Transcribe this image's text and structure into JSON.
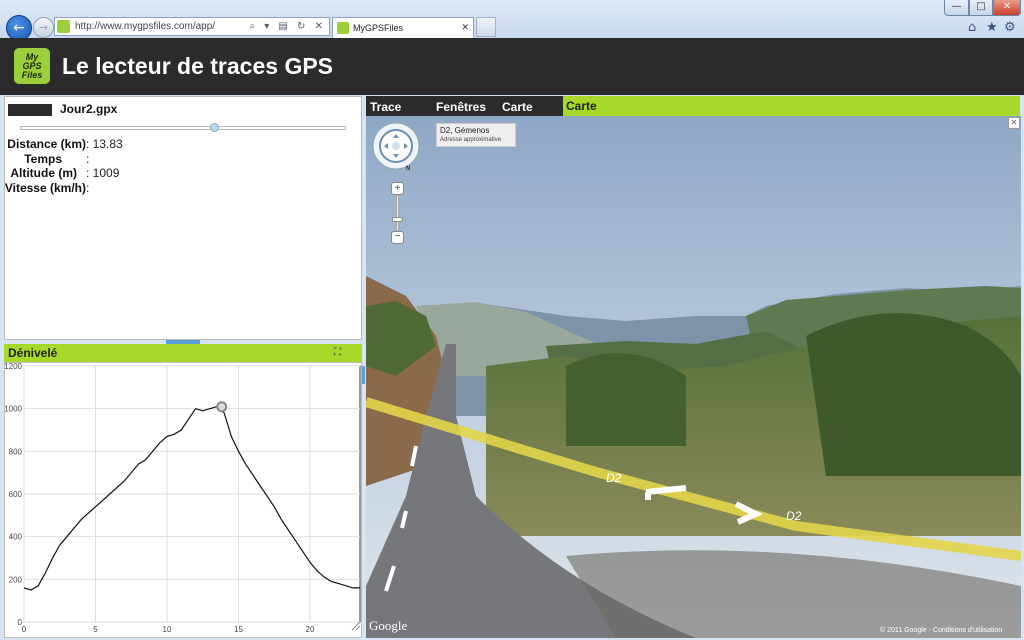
{
  "browser": {
    "url": "http://www.mygpsfiles.com/app/",
    "tab_title": "MyGPSFiles",
    "favicon_text": "My GPS",
    "address_controls": "⌕ ▾ ▤ ↻ ✕",
    "tab_close": "✕",
    "window_buttons": {
      "minimize": "—",
      "maximize": "□",
      "close": "✕"
    },
    "toolbar_icons": [
      "home-icon",
      "star-icon",
      "gear-icon"
    ]
  },
  "app": {
    "logo_lines": [
      "My",
      "GPS",
      "Files"
    ],
    "title": "Le lecteur de traces GPS"
  },
  "info_panel": {
    "file_name": "Jour2.gpx",
    "slider_position": 0.6,
    "stats": [
      {
        "label": "Distance (km)",
        "value": "13.83"
      },
      {
        "label": "Temps",
        "value": ""
      },
      {
        "label": "Altitude (m)",
        "value": "1009"
      },
      {
        "label": "Vitesse (km/h)",
        "value": ""
      }
    ]
  },
  "elevation_panel": {
    "title": "Dénivelé",
    "expand_icon": "⛶"
  },
  "chart_data": {
    "type": "line",
    "title": "",
    "xlabel": "",
    "ylabel": "",
    "xlim": [
      0,
      23.5
    ],
    "ylim": [
      0,
      1200
    ],
    "x_ticks": [
      0,
      5,
      10,
      15,
      20
    ],
    "y_ticks": [
      0,
      200,
      400,
      600,
      800,
      1000,
      1200
    ],
    "grid": true,
    "marker": {
      "x": 13.83,
      "y": 1009
    },
    "series": [
      {
        "x": [
          0,
          0.5,
          1,
          1.5,
          2,
          2.5,
          3,
          3.5,
          4,
          4.5,
          5,
          5.5,
          6,
          6.5,
          7,
          7.5,
          8,
          8.5,
          9,
          9.5,
          10,
          10.5,
          11,
          11.5,
          12,
          12.5,
          13,
          13.5,
          14,
          14.5,
          15,
          15.5,
          16,
          16.5,
          17,
          17.5,
          18,
          18.5,
          19,
          19.5,
          20,
          20.5,
          21,
          21.5,
          22,
          22.5,
          23,
          23.5
        ],
        "y": [
          160,
          150,
          170,
          230,
          300,
          360,
          400,
          440,
          480,
          510,
          540,
          570,
          600,
          630,
          660,
          700,
          740,
          760,
          800,
          840,
          870,
          880,
          900,
          950,
          1000,
          990,
          1000,
          1010,
          980,
          870,
          800,
          740,
          690,
          640,
          590,
          540,
          480,
          430,
          380,
          330,
          280,
          240,
          210,
          190,
          180,
          170,
          160,
          160
        ]
      }
    ]
  },
  "map_panel": {
    "tabs": [
      "Trace",
      "Fenêtres",
      "Carte"
    ],
    "active_tab": "Carte",
    "streetview_title": "D2, Gémenos",
    "streetview_subtitle": "Adresse approximative",
    "road_labels": [
      "D2",
      "D2"
    ],
    "close_label": "✕",
    "zoom_in": "+",
    "zoom_out": "−",
    "compass_north": "N",
    "google_logo": "Google",
    "copyright": "© 2011 Google - Conditions d'utilisation"
  }
}
